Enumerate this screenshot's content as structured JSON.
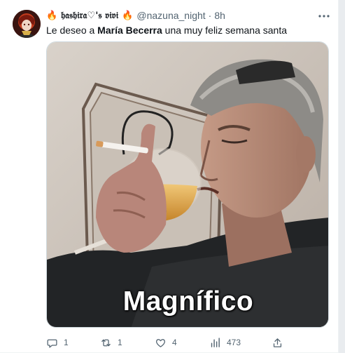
{
  "tweet": {
    "display_name": "🔥 𝔥𝔞𝔰𝔥𝔦𝔯𝔞♡'𝔰 𝔳𝔦𝔳𝔦 🔥",
    "handle": "@nazuna_night",
    "separator": "·",
    "time": "8h",
    "text_before": "Le deseo a ",
    "text_bold": "María Becerra",
    "text_after": " una muy feliz semana santa",
    "media_caption": "Magnífico"
  },
  "actions": {
    "replies": "1",
    "retweets": "1",
    "likes": "4",
    "views": "473"
  },
  "icons": {
    "more": "more-horizontal-icon",
    "reply": "reply-icon",
    "retweet": "retweet-icon",
    "like": "heart-icon",
    "views": "views-chart-icon",
    "share": "share-icon"
  },
  "colors": {
    "text": "#0f1419",
    "secondary": "#536471",
    "border": "#cfd9de"
  }
}
